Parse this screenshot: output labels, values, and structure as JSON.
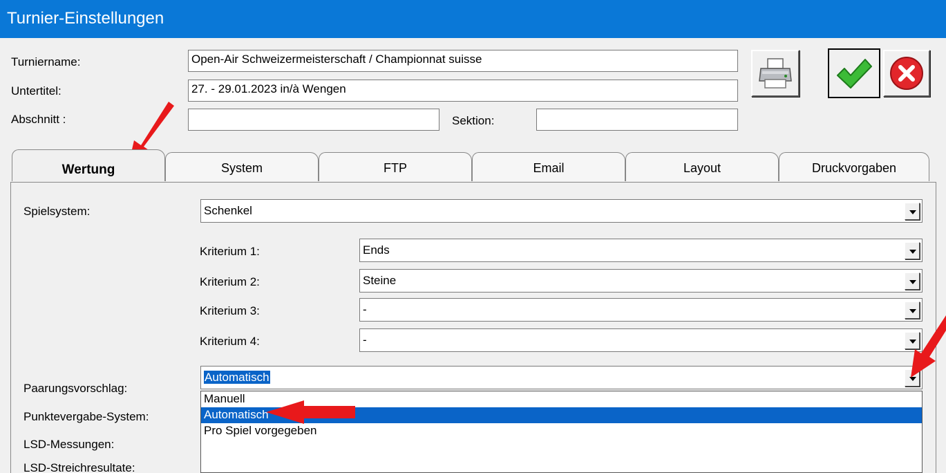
{
  "window": {
    "title": "Turnier-Einstellungen"
  },
  "header": {
    "turniername_label": "Turniername:",
    "turniername_value": "Open-Air Schweizermeisterschaft / Championnat suisse",
    "untertitel_label": "Untertitel:",
    "untertitel_value": "27. - 29.01.2023 in/à Wengen",
    "abschnitt_label": "Abschnitt :",
    "abschnitt_value": "",
    "sektion_label": "Sektion:",
    "sektion_value": ""
  },
  "toolbar": {
    "print_icon": "printer-icon",
    "ok_icon": "checkmark-icon",
    "cancel_icon": "cancel-x-icon"
  },
  "tabs": [
    {
      "label": "Wertung",
      "active": true
    },
    {
      "label": "System"
    },
    {
      "label": "FTP"
    },
    {
      "label": "Email"
    },
    {
      "label": "Layout"
    },
    {
      "label": "Druckvorgaben"
    }
  ],
  "wertung": {
    "spielsystem_label": "Spielsystem:",
    "spielsystem_value": "Schenkel",
    "kriterien": [
      {
        "label": "Kriterium 1:",
        "value": "Ends"
      },
      {
        "label": "Kriterium 2:",
        "value": "Steine"
      },
      {
        "label": "Kriterium 3:",
        "value": "-"
      },
      {
        "label": "Kriterium 4:",
        "value": "-"
      }
    ],
    "paarung_label": "Paarungsvorschlag:",
    "paarung_value": "Automatisch",
    "punkte_label": "Punktevergabe-System:",
    "lsd_label": "LSD-Messungen:",
    "lsd_streich_label": "LSD-Streichresultate:",
    "dropdown_options": [
      "Manuell",
      "Automatisch",
      "Pro Spiel vorgegeben"
    ],
    "dropdown_selected": "Automatisch"
  },
  "colors": {
    "titlebar": "#0a78d7",
    "selection": "#0a64c8",
    "annotation_arrow": "#e8191b"
  }
}
